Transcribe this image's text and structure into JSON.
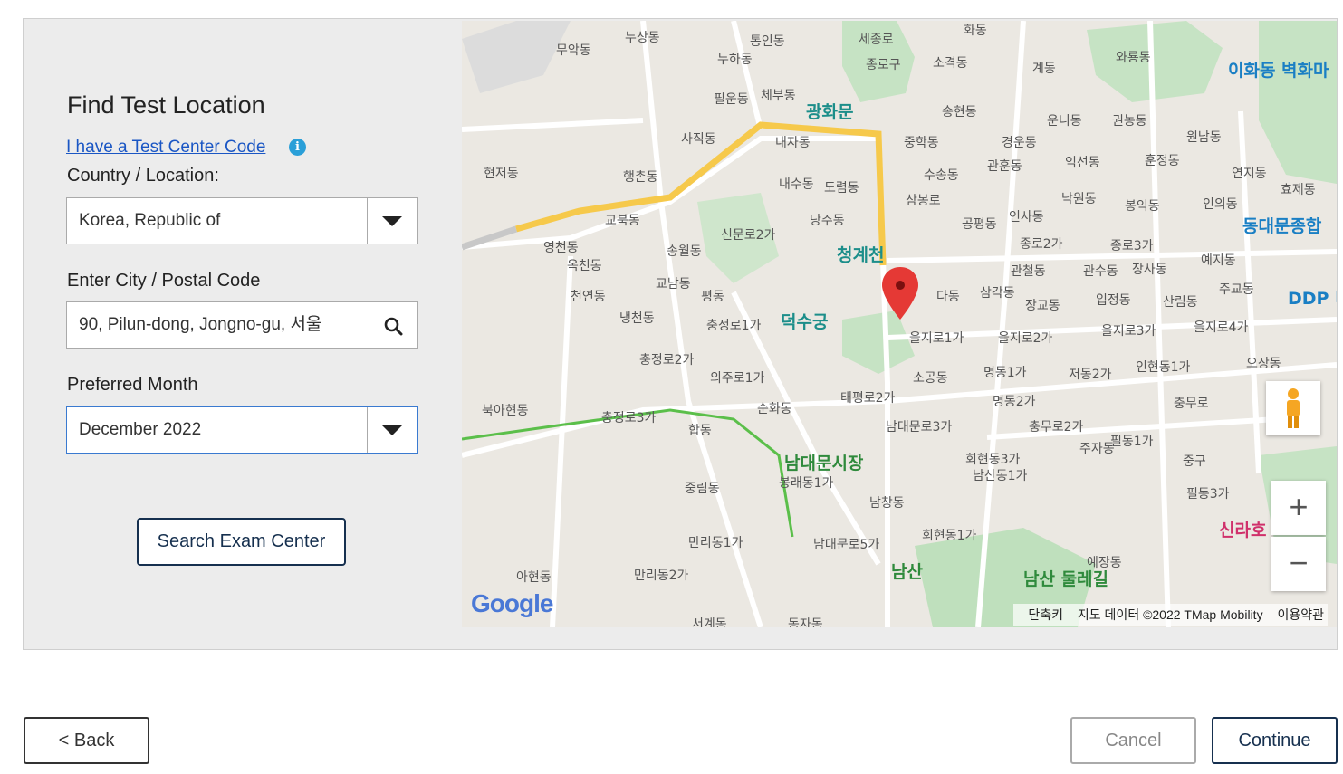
{
  "form": {
    "title": "Find Test Location",
    "code_link": "I have a Test Center Code",
    "country_label": "Country / Location:",
    "country_value": "Korea, Republic of",
    "city_label": "Enter City / Postal Code",
    "city_value": "90, Pilun-dong, Jongno-gu, 서울",
    "month_label": "Preferred Month",
    "month_value": "December 2022",
    "search_button": "Search Exam Center"
  },
  "map": {
    "labels": [
      "누상동",
      "통인동",
      "세종로",
      "화동",
      "무악동",
      "누하동",
      "종로구",
      "소격동",
      "계동",
      "와룡동",
      "이화동 벽화마",
      "필운동",
      "체부동",
      "광화문",
      "송현동",
      "운니동",
      "권농동",
      "원남동",
      "사직동",
      "내자동",
      "중학동",
      "경운동",
      "연지동",
      "현저동",
      "행촌동",
      "수송동",
      "관훈동",
      "익선동",
      "훈정동",
      "효제동",
      "내수동",
      "도렴동",
      "낙원동",
      "봉익동",
      "인의동",
      "동대문종합",
      "교북동",
      "삼봉로",
      "공평동",
      "인사동",
      "신문로2가",
      "당주동",
      "종로2가",
      "종로3가",
      "영천동",
      "송월동",
      "청계천",
      "예지동",
      "옥천동",
      "관철동",
      "관수동",
      "장사동",
      "교남동",
      "다동",
      "삼각동",
      "주교동",
      "천연동",
      "평동",
      "장교동",
      "입정동",
      "산림동",
      "DDP 디자인",
      "냉천동",
      "충정로1가",
      "덕수궁",
      "을지로1가",
      "을지로2가",
      "을지로3가",
      "을지로4가",
      "충정로2가",
      "의주로1가",
      "소공동",
      "명동1가",
      "저동2가",
      "인현동1가",
      "오장동",
      "북아현동",
      "순화동",
      "태평로2가",
      "명동2가",
      "충무로",
      "충정로3가",
      "합동",
      "남대문로3가",
      "충무로2가",
      "주자동",
      "필동1가",
      "남대문시장",
      "회현동3가",
      "중구",
      "봉래동1가",
      "남산동1가",
      "필동3가",
      "중림동",
      "남창동",
      "신라호",
      "만리동1가",
      "남대문로5가",
      "회현동1가",
      "예장동",
      "아현동",
      "만리동2가",
      "남산",
      "남산 둘레길",
      "서계동",
      "동자동"
    ],
    "attribution": [
      "단축키",
      "지도 데이터 ©2022 TMap Mobility",
      "이용약관"
    ],
    "logo": "Google",
    "zoom_in": "+",
    "zoom_out": "−"
  },
  "nav": {
    "back": "< Back",
    "cancel": "Cancel",
    "continue": "Continue"
  }
}
